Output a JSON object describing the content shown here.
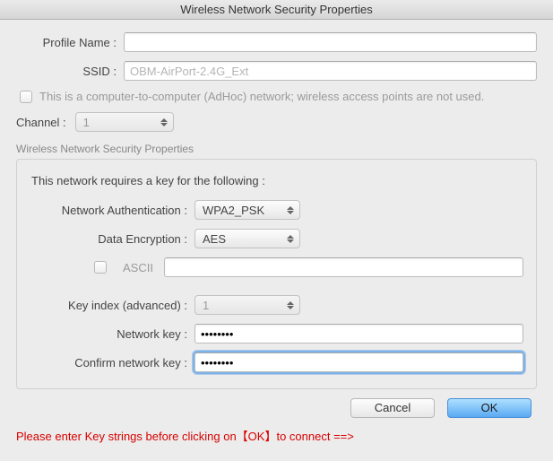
{
  "window": {
    "title": "Wireless Network Security Properties"
  },
  "profile": {
    "name_label": "Profile Name :",
    "name_value": "",
    "ssid_label": "SSID :",
    "ssid_placeholder": "OBM-AirPort-2.4G_Ext",
    "ssid_value": ""
  },
  "adhoc": {
    "checked": false,
    "label": "This is a computer-to-computer (AdHoc) network; wireless access points are not used."
  },
  "channel": {
    "label": "Channel :",
    "value": "1"
  },
  "group": {
    "caption": "Wireless Network Security Properties",
    "heading": "This network requires a key for the following :",
    "auth_label": "Network Authentication :",
    "auth_value": "WPA2_PSK",
    "encryption_label": "Data Encryption :",
    "encryption_value": "AES",
    "ascii_label": "ASCII",
    "ascii_checked": false,
    "ascii_value": "",
    "key_index_label": "Key index (advanced) :",
    "key_index_value": "1",
    "network_key_label": "Network key :",
    "network_key_value": "••••••••",
    "confirm_key_label": "Confirm network key :",
    "confirm_key_value": "••••••••"
  },
  "buttons": {
    "cancel": "Cancel",
    "ok": "OK"
  },
  "hint": "Please enter Key strings before clicking on【OK】to connect ==>"
}
